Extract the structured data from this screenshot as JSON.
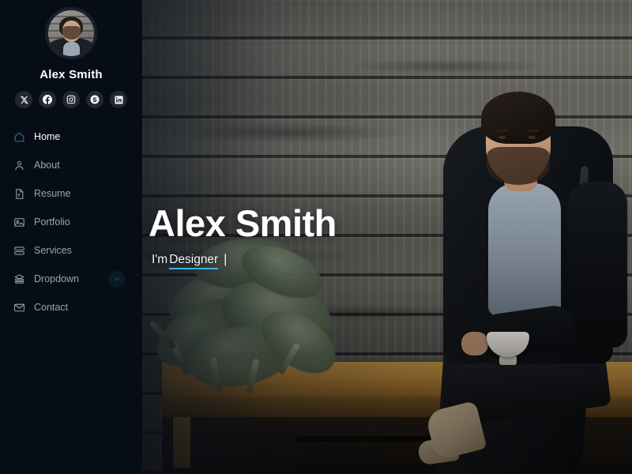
{
  "sidebar": {
    "profile": {
      "name": "Alex Smith",
      "avatar_alt": "profile-photo"
    },
    "socials": [
      {
        "name": "x-twitter",
        "label": "X"
      },
      {
        "name": "facebook",
        "label": "Facebook"
      },
      {
        "name": "instagram",
        "label": "Instagram"
      },
      {
        "name": "skype",
        "label": "Skype"
      },
      {
        "name": "linkedin",
        "label": "LinkedIn"
      }
    ],
    "nav": [
      {
        "label": "Home",
        "icon": "home-icon",
        "active": true,
        "has_chevron": false
      },
      {
        "label": "About",
        "icon": "person-icon",
        "active": false,
        "has_chevron": false
      },
      {
        "label": "Resume",
        "icon": "document-icon",
        "active": false,
        "has_chevron": false
      },
      {
        "label": "Portfolio",
        "icon": "image-icon",
        "active": false,
        "has_chevron": false
      },
      {
        "label": "Services",
        "icon": "list-icon",
        "active": false,
        "has_chevron": false
      },
      {
        "label": "Dropdown",
        "icon": "layers-icon",
        "active": false,
        "has_chevron": true
      },
      {
        "label": "Contact",
        "icon": "envelope-icon",
        "active": false,
        "has_chevron": false
      }
    ]
  },
  "hero": {
    "title": "Alex Smith",
    "subtitle_prefix": "I'm",
    "typed_word": "Designer",
    "caret": "|"
  },
  "colors": {
    "sidebar_bg": "#060d17",
    "accent": "#37b6e6",
    "active_icon": "#2f6f93",
    "nav_text": "#9aa4b0",
    "active_text": "#ffffff"
  }
}
